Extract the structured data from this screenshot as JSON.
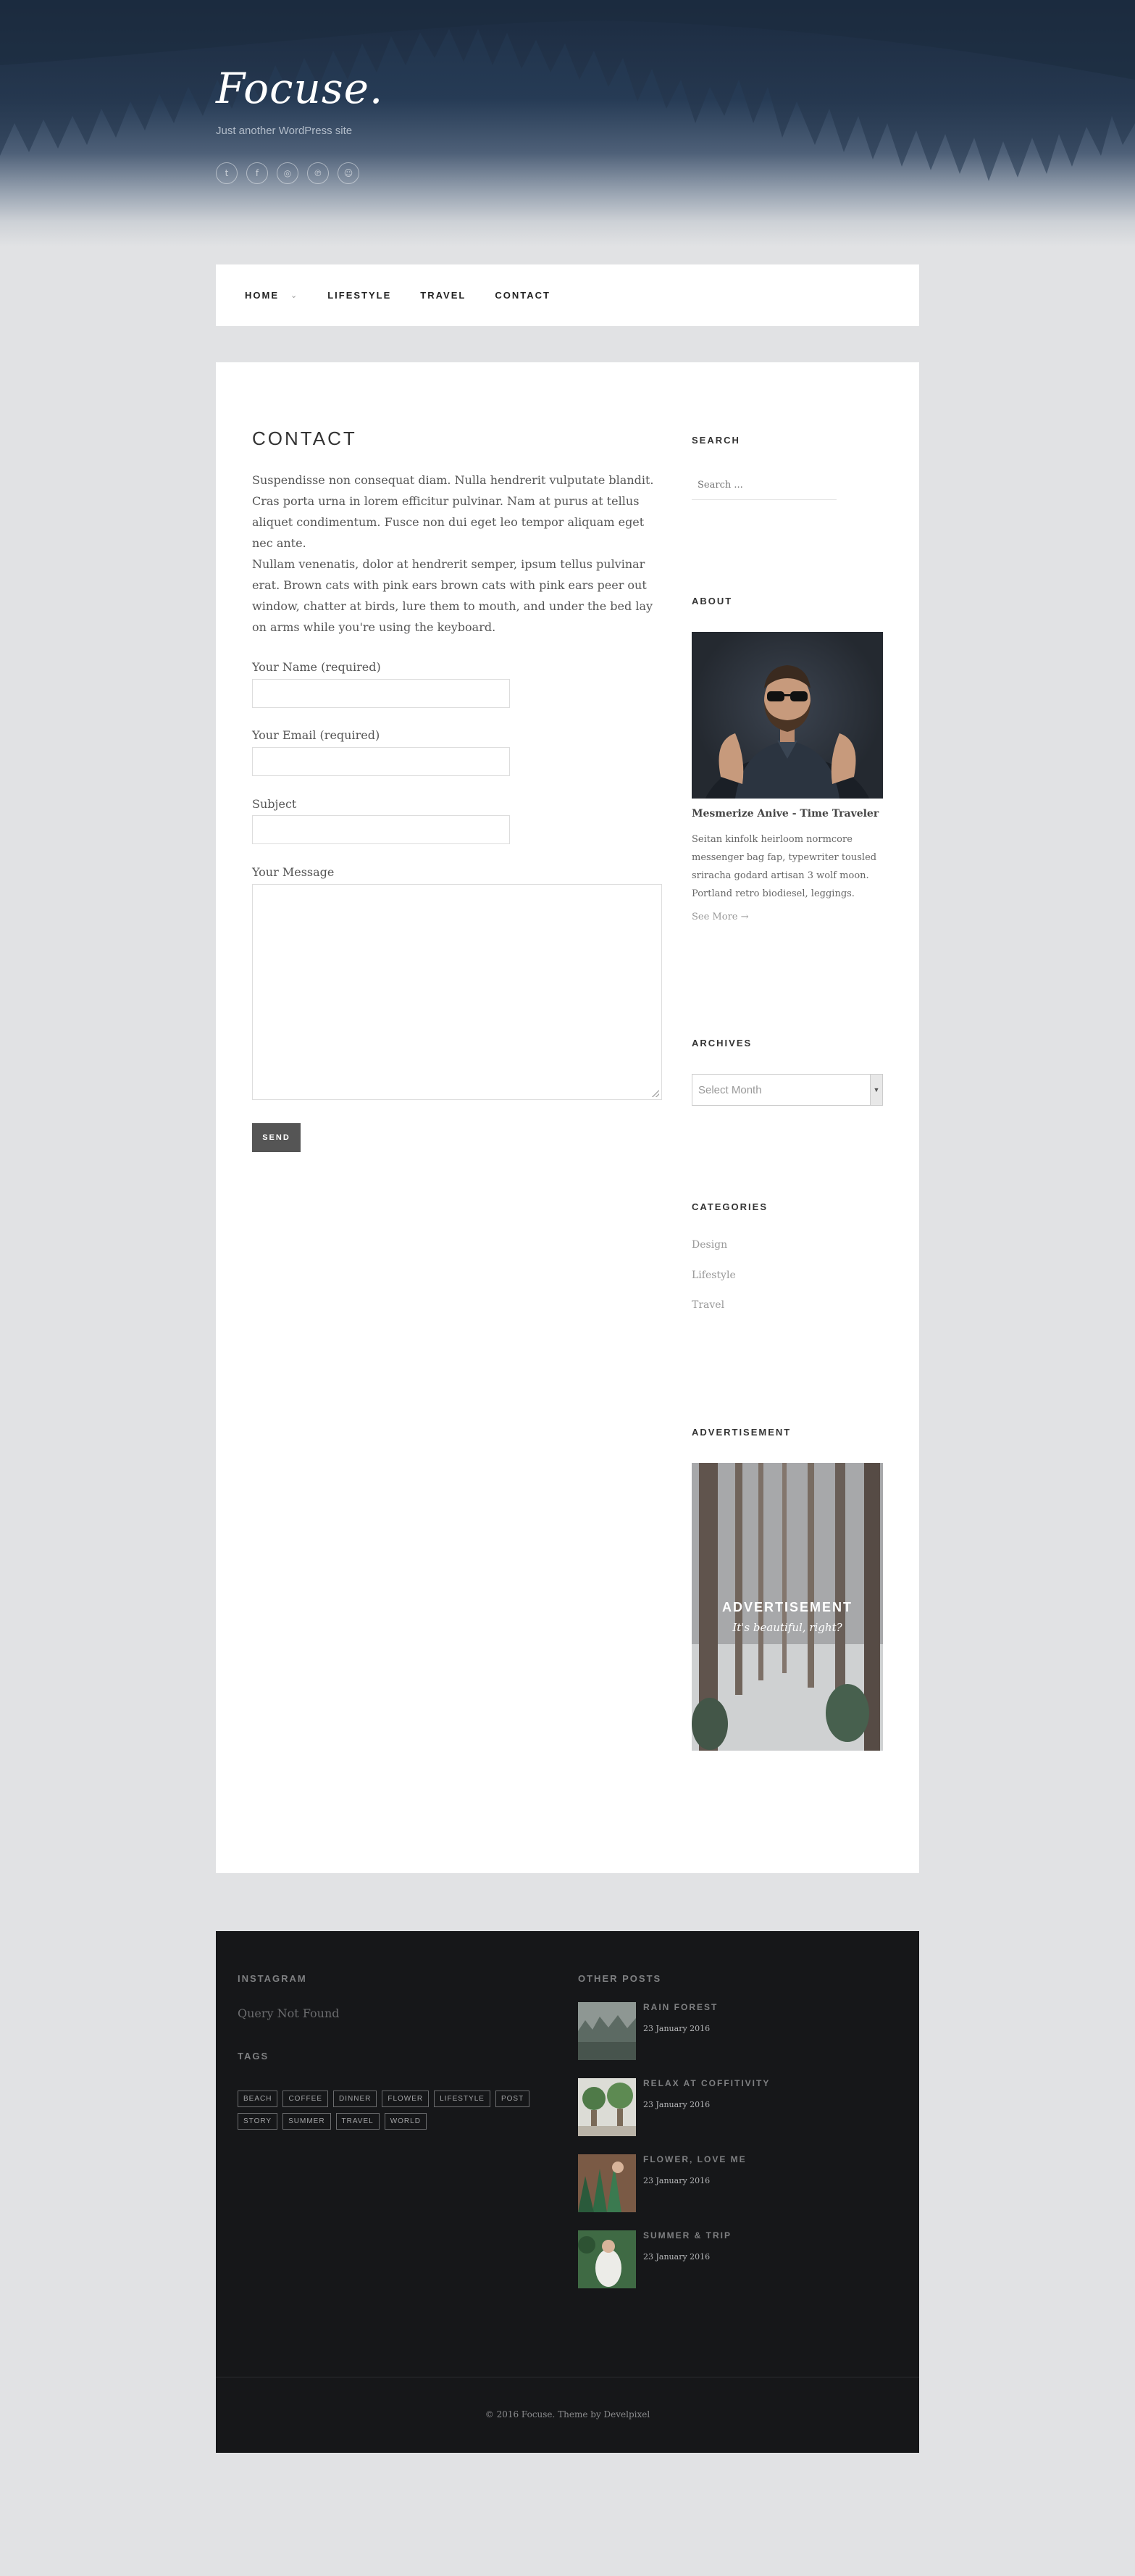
{
  "site": {
    "logo": "Focuse.",
    "tagline": "Just another WordPress site"
  },
  "social": [
    {
      "icon": "twitter-icon",
      "glyph": "t"
    },
    {
      "icon": "facebook-icon",
      "glyph": "f"
    },
    {
      "icon": "instagram-icon",
      "glyph": "◎"
    },
    {
      "icon": "pinterest-icon",
      "glyph": "℗"
    },
    {
      "icon": "profile-icon",
      "glyph": "☺"
    }
  ],
  "nav": {
    "items": [
      "HOME",
      "LIFESTYLE",
      "TRAVEL",
      "CONTACT"
    ],
    "chevron": "⌄"
  },
  "page": {
    "title": "CONTACT",
    "para1": "Suspendisse non consequat diam. Nulla hendrerit vulputate blandit. Cras porta urna in lorem efficitur pulvinar. Nam at purus at tellus aliquet condimentum. Fusce non dui eget leo tempor aliquam eget nec ante.",
    "para2": "Nullam venenatis, dolor at hendrerit semper, ipsum tellus pulvinar erat. Brown cats with pink ears brown cats with pink ears peer out window, chatter at birds, lure them to mouth, and under the bed lay on arms while you're using the keyboard."
  },
  "form": {
    "name_label": "Your Name (required)",
    "email_label": "Your Email (required)",
    "subject_label": "Subject",
    "message_label": "Your Message",
    "send_label": "SEND"
  },
  "sidebar": {
    "search_title": "SEARCH",
    "search_placeholder": "Search ...",
    "about_title": "ABOUT",
    "about_name": "Mesmerize Anive - Time Traveler",
    "about_text": "Seitan kinfolk heirloom normcore messenger bag fap, typewriter tousled sriracha godard artisan 3 wolf moon. Portland retro biodiesel, leggings.",
    "see_more": "See More →",
    "archives_title": "ARCHIVES",
    "archives_select": "Select Month",
    "categories_title": "CATEGORIES",
    "categories": [
      "Design",
      "Lifestyle",
      "Travel"
    ],
    "ad_title": "ADVERTISEMENT",
    "ad_heading": "ADVERTISEMENT",
    "ad_sub": "It's beautiful, right?"
  },
  "footer": {
    "instagram_title": "INSTAGRAM",
    "instagram_empty": "Query Not Found",
    "tags_title": "TAGS",
    "tags": [
      "BEACH",
      "COFFEE",
      "DINNER",
      "FLOWER",
      "LIFESTYLE",
      "POST",
      "STORY",
      "SUMMER",
      "TRAVEL",
      "WORLD"
    ],
    "other_posts_title": "OTHER POSTS",
    "posts": [
      {
        "title": "RAIN FOREST",
        "date": "23 January 2016"
      },
      {
        "title": "RELAX AT COFFITIVITY",
        "date": "23 January 2016"
      },
      {
        "title": "FLOWER, LOVE ME",
        "date": "23 January 2016"
      },
      {
        "title": "SUMMER & TRIP",
        "date": "23 January 2016"
      }
    ],
    "copyright": "© 2016 Focuse. Theme by Develpixel"
  }
}
